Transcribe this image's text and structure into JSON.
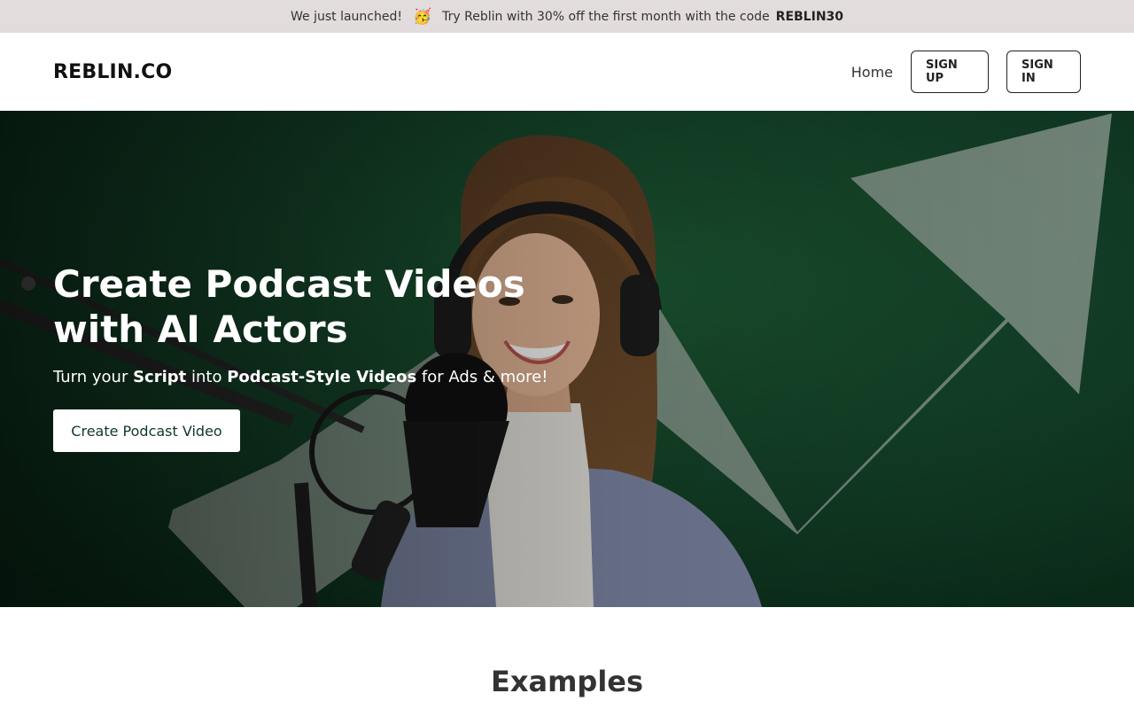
{
  "announcement": {
    "prefix": "We just launched!",
    "emoji": "🥳",
    "message": "Try Reblin with 30% off the first month with the code",
    "code": "REBLIN30"
  },
  "header": {
    "logo": "REBLIN.CO",
    "nav": {
      "home": "Home",
      "sign_up": "SIGN UP",
      "sign_in": "SIGN IN"
    }
  },
  "hero": {
    "title": "Create Podcast Videos with AI Actors",
    "subtitle": {
      "part1": "Turn your ",
      "bold1": "Script",
      "part2": " into ",
      "bold2": "Podcast-Style Videos",
      "part3": " for Ads & more!"
    },
    "cta": "Create Podcast Video"
  },
  "examples": {
    "heading": "Examples"
  },
  "colors": {
    "announcement_bg": "#e3dcdc",
    "hero_green": "#0c3a22",
    "accent_text": "#0f3a22"
  }
}
